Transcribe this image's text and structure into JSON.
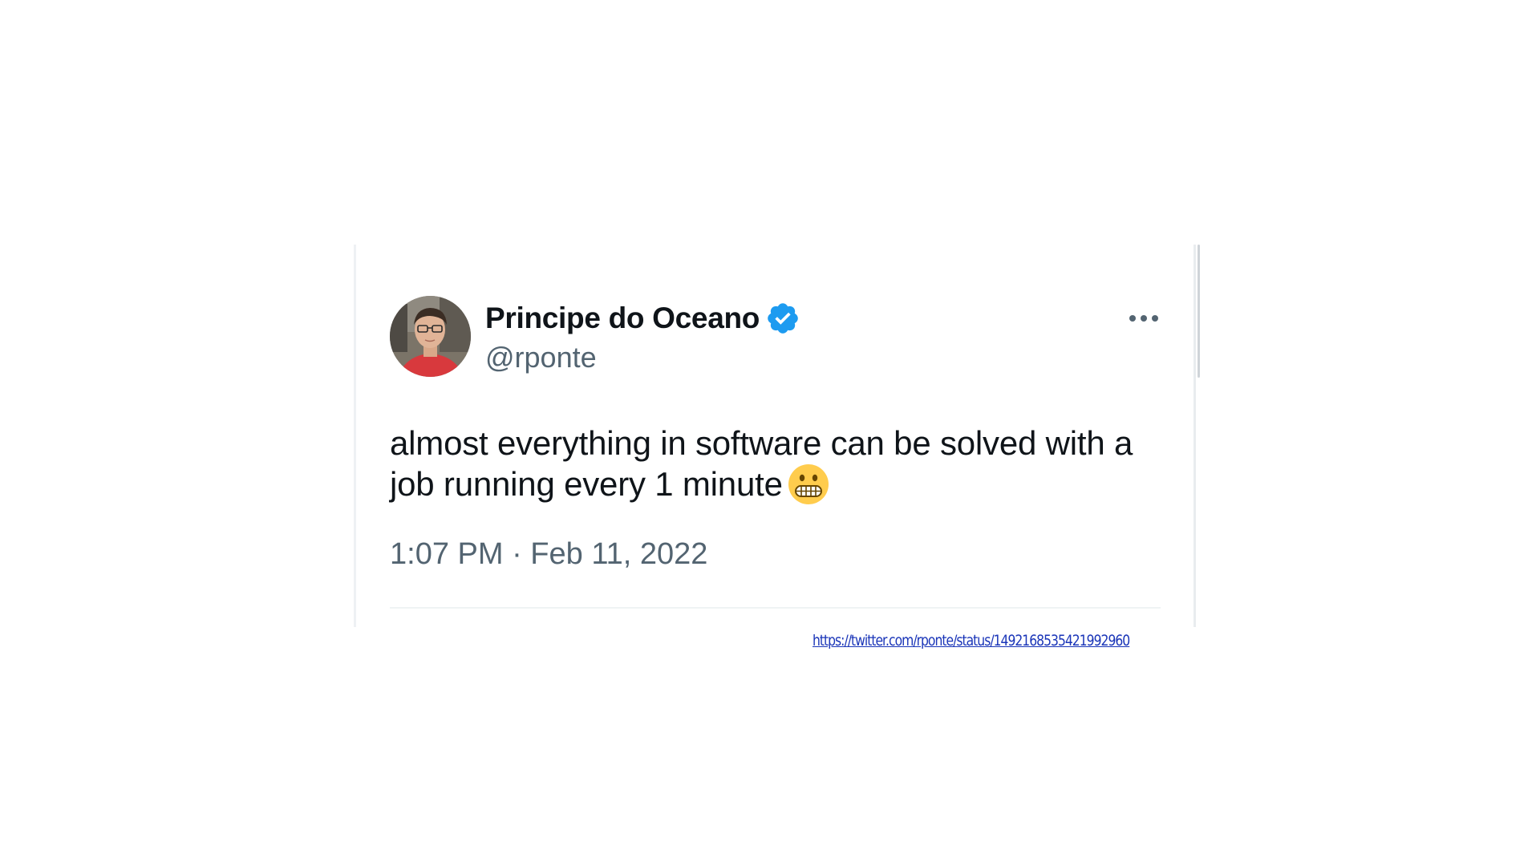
{
  "tweet": {
    "display_name": "Principe do Oceano",
    "handle": "@rponte",
    "verified_icon": "verified-badge-icon",
    "verified_color": "#1d9bf0",
    "more_icon": "more-horizontal-icon",
    "text": "almost everything in software can be solved with a job running every 1 minute",
    "emoji": "grimacing-face",
    "timestamp": "1:07 PM · Feb 11, 2022"
  },
  "source": {
    "url": "https://twitter.com/rponte/status/1492168535421992960"
  },
  "colors": {
    "text_primary": "#0f1419",
    "text_secondary": "#536471",
    "link": "#1a35b8"
  }
}
